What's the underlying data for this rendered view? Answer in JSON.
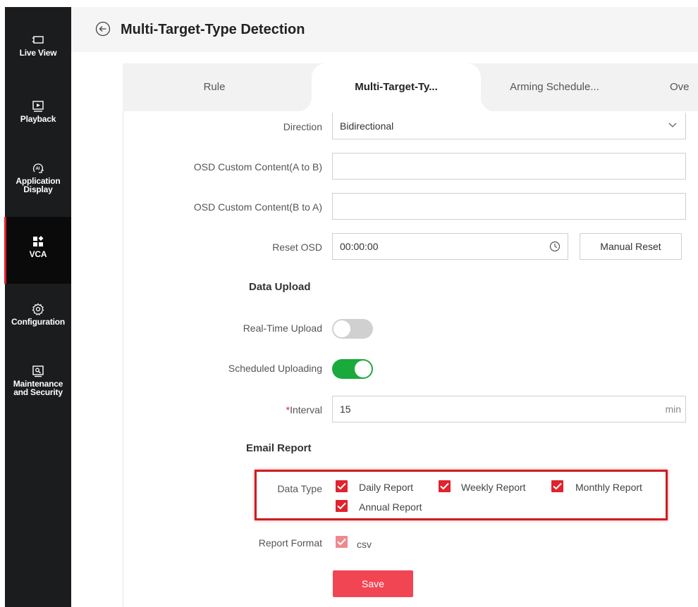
{
  "sidebar": {
    "items": [
      {
        "label": [
          "Live View"
        ],
        "icon": "live-view-icon"
      },
      {
        "label": [
          "Playback"
        ],
        "icon": "playback-icon"
      },
      {
        "label": [
          "Application",
          "Display"
        ],
        "icon": "ai-icon"
      },
      {
        "label": [
          "VCA"
        ],
        "icon": "vca-icon",
        "active": true
      },
      {
        "label": [
          "Configuration"
        ],
        "icon": "gear-icon"
      },
      {
        "label": [
          "Maintenance",
          "and Security"
        ],
        "icon": "maintenance-icon"
      }
    ]
  },
  "header": {
    "title": "Multi-Target-Type Detection",
    "back_icon": "back-arrow-icon"
  },
  "tabs": [
    {
      "label": "Rule"
    },
    {
      "label": "Multi-Target-Ty...",
      "active": true
    },
    {
      "label": "Arming Schedule..."
    },
    {
      "label": "Ove"
    }
  ],
  "form": {
    "direction": {
      "label": "Direction",
      "value": "Bidirectional"
    },
    "osd_a_to_b": {
      "label": "OSD Custom Content(A to B)",
      "value": ""
    },
    "osd_b_to_a": {
      "label": "OSD Custom Content(B to A)",
      "value": ""
    },
    "reset_osd": {
      "label": "Reset OSD",
      "value": "00:00:00",
      "button": "Manual Reset"
    },
    "data_upload": {
      "title": "Data Upload",
      "real_time": {
        "label": "Real-Time Upload",
        "enabled": false
      },
      "scheduled": {
        "label": "Scheduled Uploading",
        "enabled": true
      },
      "interval": {
        "required_mark": "*",
        "label": "Interval",
        "value": "15",
        "unit": "min"
      }
    },
    "email_report": {
      "title": "Email Report",
      "data_type_label": "Data Type",
      "types": [
        {
          "label": "Daily Report",
          "checked": true
        },
        {
          "label": "Weekly Report",
          "checked": true
        },
        {
          "label": "Monthly Report",
          "checked": true
        },
        {
          "label": "Annual Report",
          "checked": true
        }
      ],
      "format_label": "Report Format",
      "format_value": "csv"
    },
    "save": "Save"
  },
  "colors": {
    "accent": "#e0232d",
    "toggle_on": "#1aaa3c",
    "toggle_off": "#d0d0d0",
    "sidebar": "#1b1c1e"
  }
}
